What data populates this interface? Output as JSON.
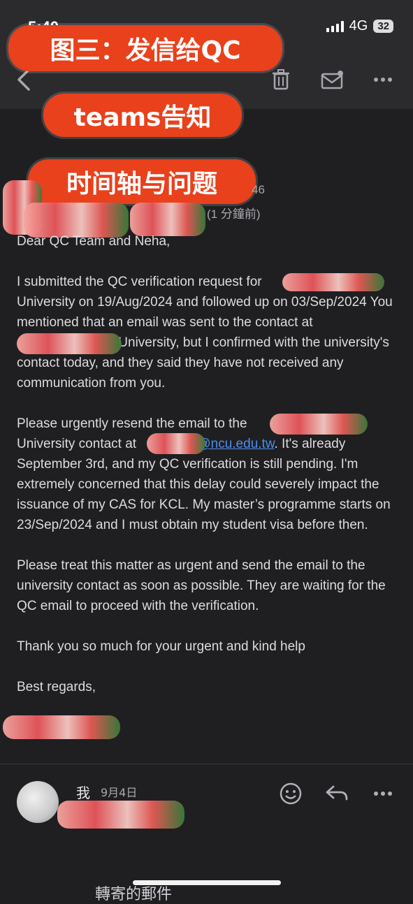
{
  "status_bar": {
    "time": "5:40",
    "network": "4G",
    "battery": "32"
  },
  "overlay_labels": [
    "图三：发信给QC",
    "teams告知",
    "时间轴与问题"
  ],
  "sender": {
    "number_suffix": "46",
    "time_ago": "(1 分鐘前)"
  },
  "email": {
    "greeting": "Dear QC Team and Neha,",
    "p1_a": "I submitted the QC verification request for",
    "p1_b": "University on 19/Aug/2024 and followed up on 03/Sep/2024 You mentioned that an email was sent to the contact at",
    "p1_c": "University, but I confirmed with the university's contact today, and they said they have not received any communication from you.",
    "p2_a": "Please urgently resend the email to the",
    "p2_b": "University contact at",
    "p2_link": "@ncu.edu.tw",
    "p2_c": ". It's already September 3rd, and my QC verification is still pending. I'm extremely concerned that this delay could severely impact the issuance of my CAS for KCL. My master’s programme starts on 23/Sep/2024 and I must obtain my student visa before then.",
    "p3": "Please treat this matter as urgent and send the email to the university contact as soon as possible. They are waiting for the QC email to proceed with the verification.",
    "p4": "Thank you so much for your urgent and kind help",
    "closing": "Best regards,"
  },
  "reply": {
    "sender": "我",
    "date": "9月4日"
  },
  "footer": {
    "forwarded": "轉寄的郵件"
  },
  "icons": [
    "back-icon",
    "trash-icon",
    "mail-icon",
    "more-icon",
    "emoji-icon",
    "reply-icon"
  ]
}
